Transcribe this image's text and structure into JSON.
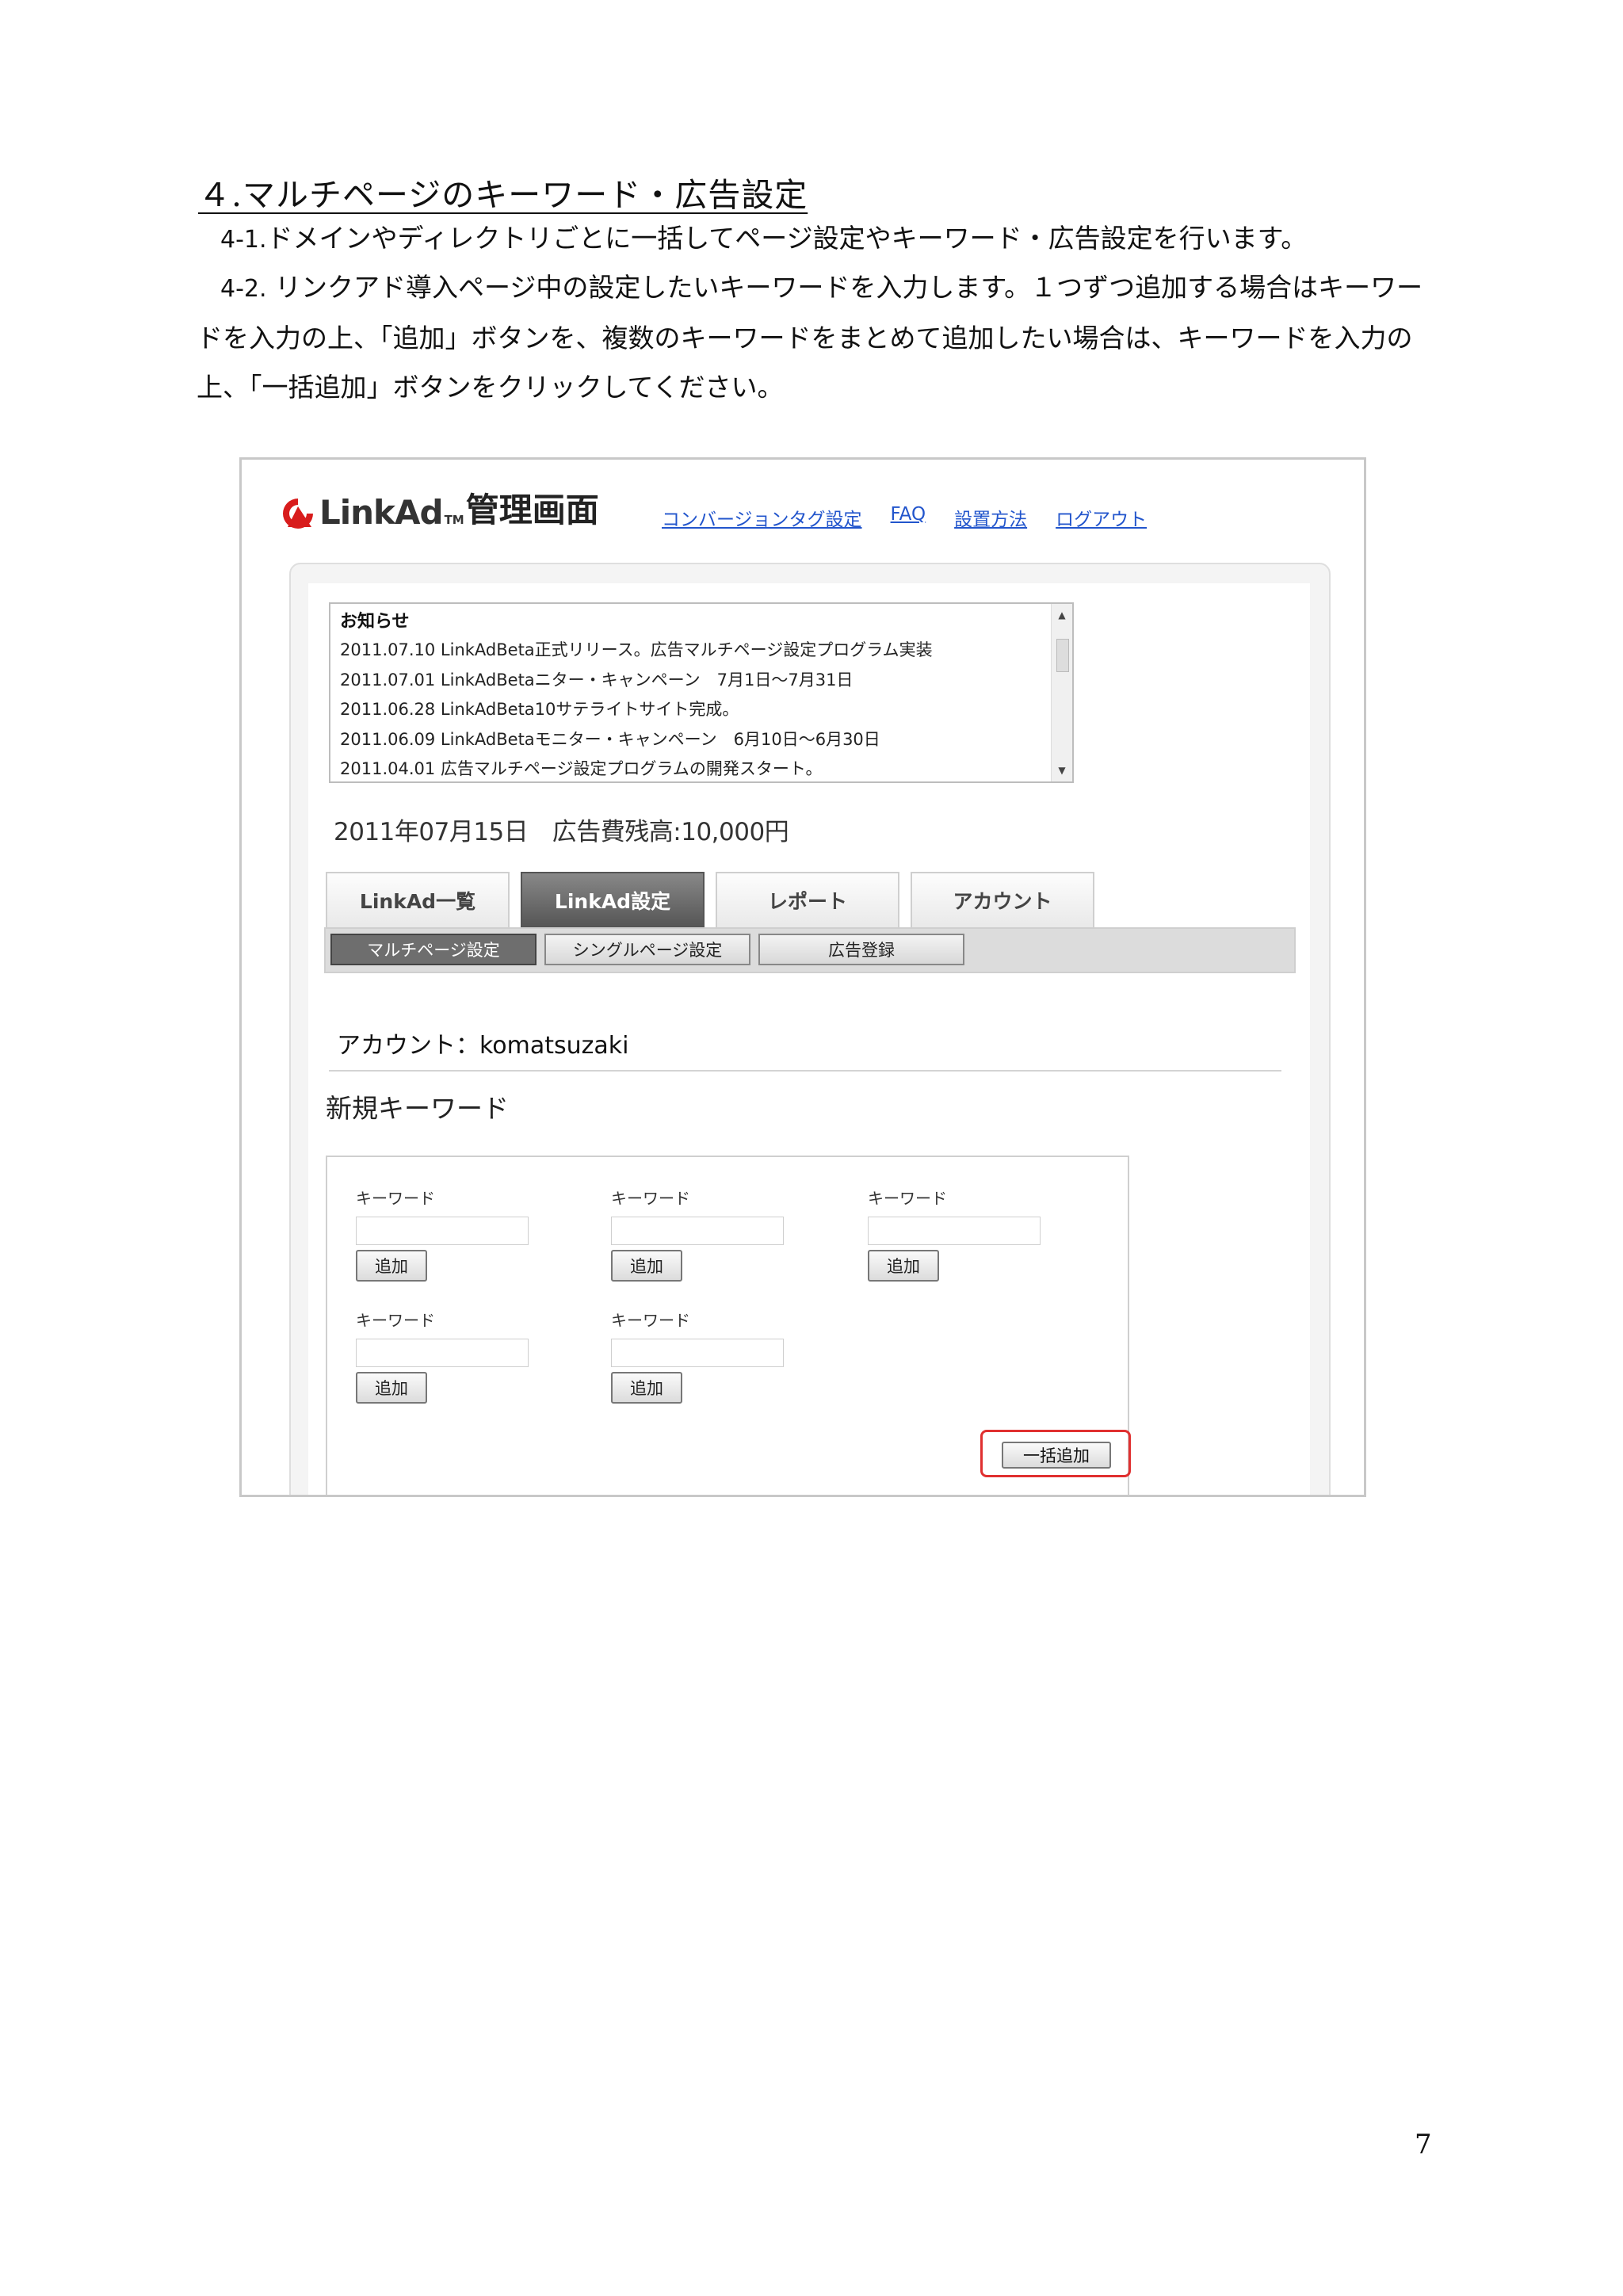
{
  "document": {
    "title": "４.マルチページのキーワード・広告設定",
    "p1_step": "4-1.",
    "p1_text": "ドメインやディレクトリごとに一括してページ設定やキーワード・広告設定を行います。",
    "p2_step": "4-2.",
    "p2_text": "リンクアド導入ページ中の設定したいキーワードを入力します。１つずつ追加する場合はキーワードを入力の上、「追加」ボタンを、複数のキーワードをまとめて追加したい場合は、キーワードを入力の上、「一括追加」ボタンをクリックしてください。",
    "page_number": "7"
  },
  "app": {
    "logo_text": "LinkAd",
    "logo_tm": "TM",
    "logo_admin": "管理画面",
    "nav": [
      "コンバージョンタグ設定",
      "FAQ",
      "設置方法",
      "ログアウト"
    ],
    "notice_heading": "お知らせ",
    "notices": [
      "2011.07.10 LinkAdBeta正式リリース。広告マルチページ設定プログラム実装",
      "2011.07.01 LinkAdBetaニター・キャンペーン　7月1日～7月31日",
      "2011.06.28 LinkAdBeta10サテライトサイト完成。",
      "2011.06.09 LinkAdBetaモニター・キャンペーン　6月10日～6月30日",
      "2011.04.01 広告マルチページ設定プログラムの開発スタート。"
    ],
    "balance": "2011年07月15日　広告費残高:10,000円",
    "tabs": [
      "LinkAd一覧",
      "LinkAd設定",
      "レポート",
      "アカウント"
    ],
    "subtabs": [
      "マルチページ設定",
      "シングルページ設定",
      "広告登録"
    ],
    "account": "アカウント：komatsuzaki",
    "section_heading": "新規キーワード",
    "keyword_label": "キーワード",
    "add_button": "追加",
    "bulk_add_button": "一括追加",
    "colors": {
      "link": "#2255cc",
      "logo_red": "#d81c1c",
      "highlight": "#e03030"
    }
  }
}
